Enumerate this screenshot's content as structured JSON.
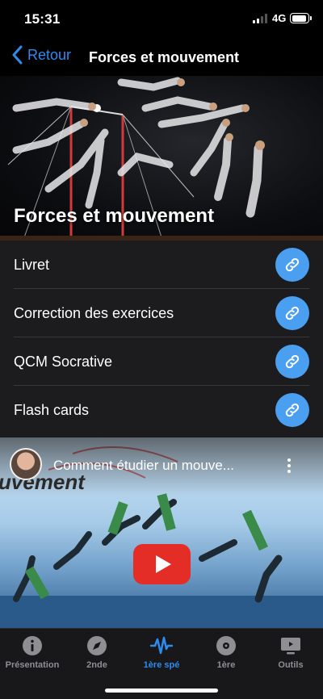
{
  "status": {
    "time": "15:31",
    "network": "4G"
  },
  "nav": {
    "back_label": "Retour",
    "title": "Forces et mouvement"
  },
  "hero": {
    "title": "Forces et mouvement"
  },
  "links": [
    {
      "label": "Livret",
      "icon": "link-icon"
    },
    {
      "label": "Correction des exercices",
      "icon": "link-icon"
    },
    {
      "label": "QCM Socrative",
      "icon": "link-icon"
    },
    {
      "label": "Flash cards",
      "icon": "link-icon"
    }
  ],
  "video": {
    "title": "Comment étudier un mouve...",
    "overlay_text": "uvement",
    "play_icon": "play-icon",
    "more_icon": "more-vertical-icon"
  },
  "tabs": [
    {
      "label": "Présentation",
      "icon": "info-icon",
      "active": false
    },
    {
      "label": "2nde",
      "icon": "compass-icon",
      "active": false
    },
    {
      "label": "1ère spé",
      "icon": "waveform-icon",
      "active": true
    },
    {
      "label": "1ère",
      "icon": "disc-icon",
      "active": false
    },
    {
      "label": "Outils",
      "icon": "tv-icon",
      "active": false
    }
  ],
  "colors": {
    "accent": "#2e8bf0",
    "link_button": "#4a9ff0",
    "youtube_red": "#e52d27",
    "list_bg": "#1c1c1e"
  }
}
